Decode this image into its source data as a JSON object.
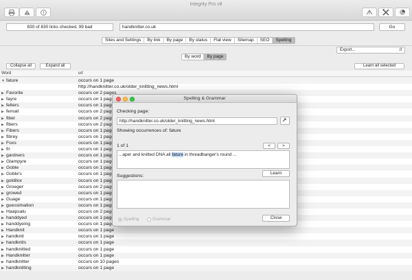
{
  "app": {
    "title": "Integrity Pro v8"
  },
  "toolbar": {
    "left_icons": [
      "printer-icon",
      "warning-icon",
      "stop-icon"
    ],
    "right_icons": [
      "antenna-icon",
      "tools-icon",
      "pie-chart-icon"
    ]
  },
  "scan": {
    "status": "830 of 830 links checked, 99 bad",
    "url": "handknitter.co.uk",
    "go_label": "Go"
  },
  "view_tabs": [
    "Sites and Settings",
    "By link",
    "By page",
    "By status",
    "Flat view",
    "Sitemap",
    "SEO",
    "Spelling"
  ],
  "active_tab": "Spelling",
  "export": {
    "label": "Export..."
  },
  "grouping": {
    "options": [
      "By word",
      "By page"
    ],
    "selected": "By page"
  },
  "buttons": {
    "collapse_all": "Collapse all",
    "expand_all": "Expand all",
    "learn_all": "Learn all selected"
  },
  "table": {
    "headers": [
      "Word",
      "url"
    ],
    "rows": [
      {
        "word": "fature",
        "url": "occurs on 1 page",
        "expanded": true
      },
      {
        "word": "",
        "url": "http://handknitter.co.uk/older_knitting_news.html",
        "child": true
      },
      {
        "word": "Favorite",
        "url": "occurs on 2 pages"
      },
      {
        "word": "fayre",
        "url": "occurs on 1 page"
      },
      {
        "word": "felters",
        "url": "occurs on 1 page"
      },
      {
        "word": "femail",
        "url": "occurs on 2 pages"
      },
      {
        "word": "fiber",
        "url": "occurs on 2 pages"
      },
      {
        "word": "fibers",
        "url": "occurs on 2 pages"
      },
      {
        "word": "Fibers",
        "url": "occurs on 1 page"
      },
      {
        "word": "fibrey",
        "url": "occurs on 1 page"
      },
      {
        "word": "Foxs",
        "url": "occurs on 1 page"
      },
      {
        "word": "fri",
        "url": "occurs on 1 page"
      },
      {
        "word": "gardners",
        "url": "occurs on 1 page"
      },
      {
        "word": "Glampyre",
        "url": "occurs on 1 page"
      },
      {
        "word": "Goble",
        "url": "occurs on 1 page"
      },
      {
        "word": "Goble's",
        "url": "occurs on 1 page"
      },
      {
        "word": "goldilox",
        "url": "occurs on 1 page"
      },
      {
        "word": "Groeger",
        "url": "occurs on 2 pages"
      },
      {
        "word": "growed",
        "url": "occurs on 1 page"
      },
      {
        "word": "Guage",
        "url": "occurs on 1 page"
      },
      {
        "word": "guessimation",
        "url": "occurs on 1 page"
      },
      {
        "word": "Haapsalu",
        "url": "occurs on 2 pages"
      },
      {
        "word": "handdyed",
        "url": "occurs on 1 page"
      },
      {
        "word": "handdyeing",
        "url": "occurs on 1 page"
      },
      {
        "word": "Handknit",
        "url": "occurs on 1 page"
      },
      {
        "word": "handknit",
        "url": "occurs on 1 page"
      },
      {
        "word": "handknits",
        "url": "occurs on 1 page"
      },
      {
        "word": "handknitted",
        "url": "occurs on 1 page"
      },
      {
        "word": "Handknitter",
        "url": "occurs on 1 page"
      },
      {
        "word": "handknitter",
        "url": "occurs on 10 pages"
      },
      {
        "word": "handknitting",
        "url": "occurs on 1 page"
      }
    ]
  },
  "dialog": {
    "title": "Spelling & Grammar",
    "checking_label": "Checking page:",
    "page_url": "http://handknitter.co.uk/older_knitting_news.html",
    "occurrences_label": "Showing occurrences of:",
    "word": "fature",
    "counter": "1 of 1",
    "prev_label": "<",
    "next_label": ">",
    "context_before": "...aper and knitted DNA all ",
    "context_word": "fature",
    "context_after": " in threadbanger's round ...",
    "learn_label": "Learn",
    "suggestions_label": "Suggestions:",
    "radio_spelling": "Spelling",
    "radio_grammar": "Grammar",
    "close_label": "Close"
  }
}
